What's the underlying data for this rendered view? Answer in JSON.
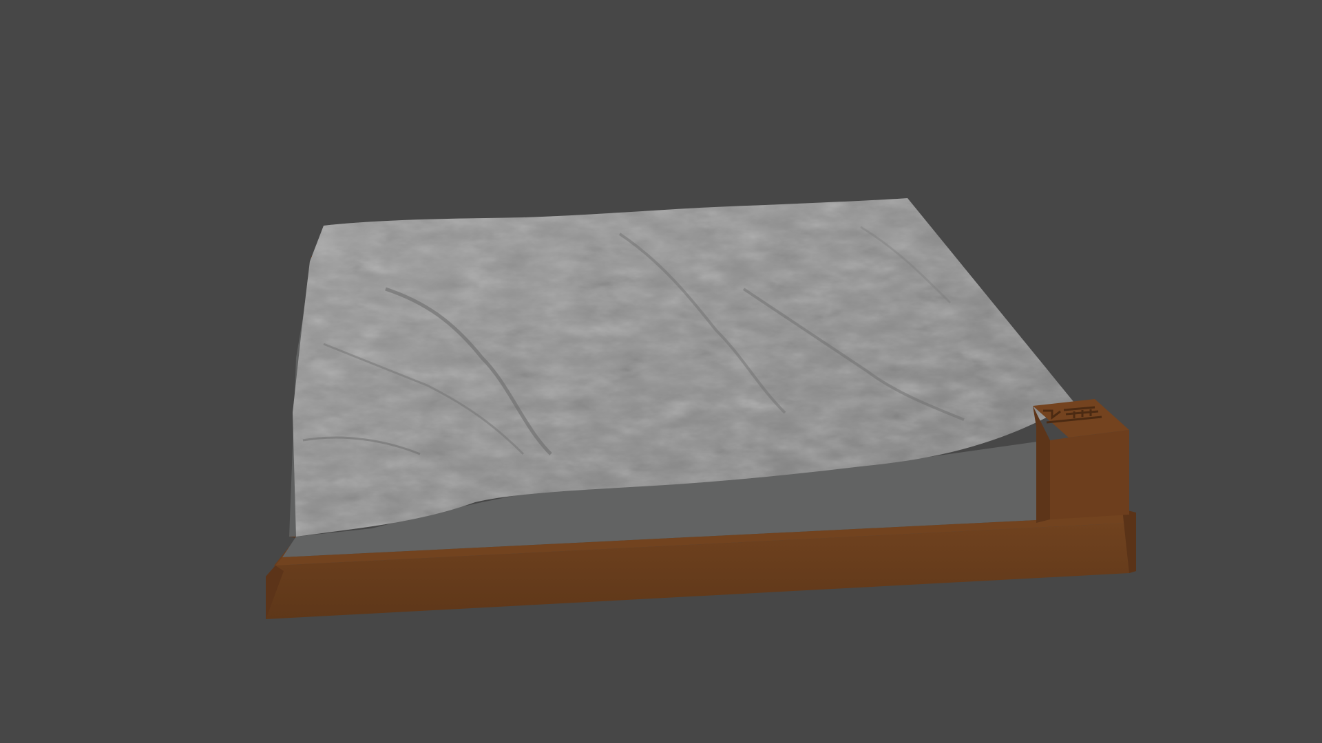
{
  "viewport": {
    "background_color": "#474747"
  },
  "model": {
    "terrain_top_color": "#8e8e8e",
    "terrain_side_color": "#636464",
    "base_frame_color": "#6b3f1f",
    "base_frame_dark_color": "#52301a",
    "label_block_color": "#713f20",
    "label_block_icon": "north-arrow-and-scale-engraving"
  }
}
